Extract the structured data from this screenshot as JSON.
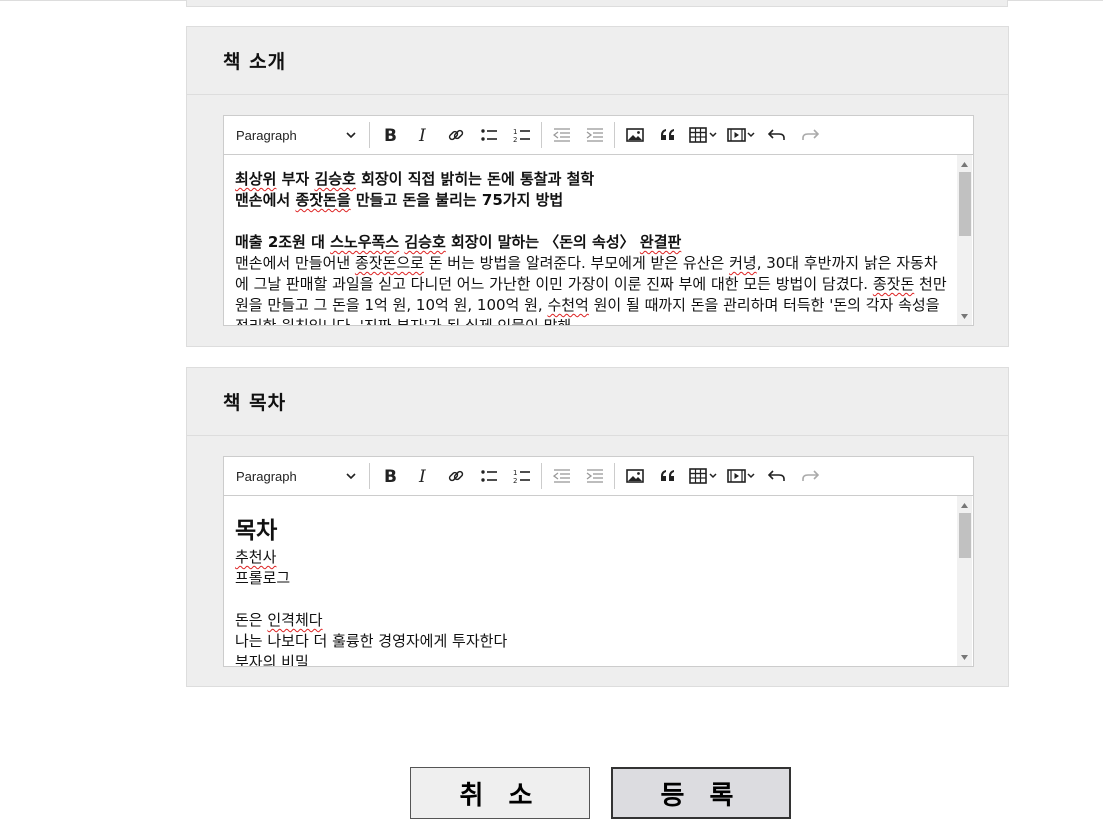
{
  "intro_section": {
    "title": "책 소개",
    "toolbar": {
      "paragraph_label": "Paragraph"
    },
    "content": {
      "line1a": "최상위",
      "line1b": " 부자 ",
      "line1c": "김승호",
      "line1d": " 회장이 직접 밝히는 돈에 통찰과 철학",
      "line2a": "맨손에서 ",
      "line2b": "종잣돈을",
      "line2c": " 만들고 돈을 불리는 75가지 방법",
      "line3a": "매출 2조원 대 ",
      "line3b": "스노우폭스",
      "line3c": " ",
      "line3d": "김승호",
      "line3e": " 회장이 말하는 〈돈의 속성〉 ",
      "line3f": "완결판",
      "para_a": "맨손에서 만들어낸 ",
      "para_b": "종잣돈으로",
      "para_c": " 돈 버는 방법을 알려준다. 부모에게 받은 유산은 ",
      "para_d": "커녕",
      "para_e": ", 30대 후반까지 낡은 자동차에 그날 판매할 과일을 싣고 다니던 어느 가난한 이민 가장이 이룬 진짜 부에 대한 모든 방법이 담겼다. ",
      "para_f": "종잣돈",
      "para_g": " 천만 원을 만들고 그 돈을 1억 원, 10억 원, 100억 원, ",
      "para_h": "수천억",
      "para_i": " 원이 될 때까지 돈을 관리하며 터득한 '돈의 각자 속성을 정리한 원칙입니다. '진짜 부자'가 된 실제 인물이 말해"
    }
  },
  "toc_section": {
    "title": "책 목차",
    "toolbar": {
      "paragraph_label": "Paragraph"
    },
    "content": {
      "heading": "목차",
      "item1": "추천사",
      "item2": "프롤로그",
      "item3a": "돈은 ",
      "item3b": "인격체다",
      "item4": "나는 나보다 더 훌륭한 경영자에게 투자한다",
      "item5": "부자의 비밀"
    }
  },
  "buttons": {
    "cancel": "취 소",
    "submit": "등 록"
  }
}
